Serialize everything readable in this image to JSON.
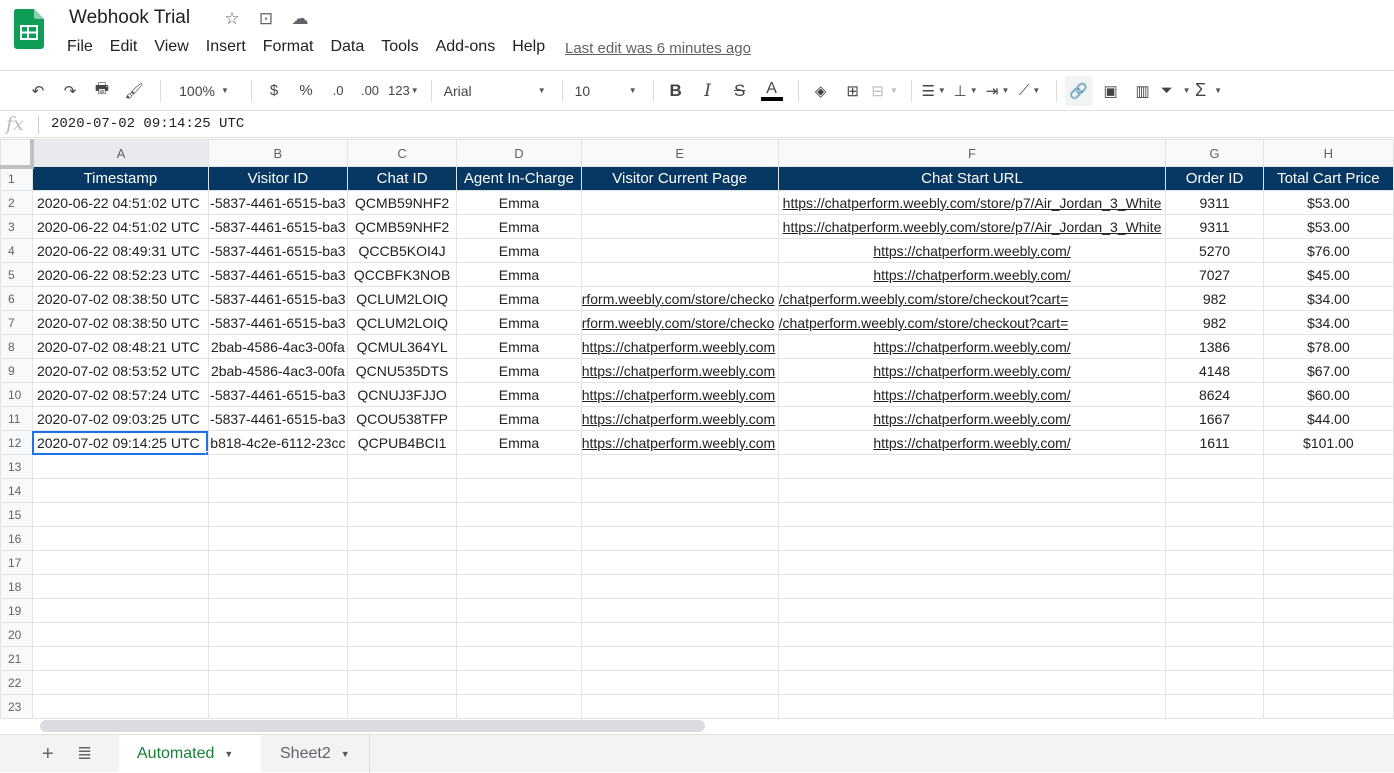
{
  "app": {
    "title": "Webhook Trial",
    "last_edit": "Last edit was 6 minutes ago",
    "menu": [
      "File",
      "Edit",
      "View",
      "Insert",
      "Format",
      "Data",
      "Tools",
      "Add-ons",
      "Help"
    ]
  },
  "toolbar": {
    "zoom": "100%",
    "currency": "$",
    "percent": "%",
    "decrease_decimal": ".0",
    "increase_decimal": ".00",
    "more_formats": "123",
    "font": "Arial",
    "font_size": "10",
    "bold": "B",
    "italic": "I",
    "strike": "S",
    "text_color": "A",
    "sum": "Σ"
  },
  "formula_bar": {
    "fx": "fx",
    "value": "2020-07-02 09:14:25 UTC"
  },
  "sheet": {
    "columns": [
      "A",
      "B",
      "C",
      "D",
      "E",
      "F",
      "G",
      "H"
    ],
    "header_row": [
      "Timestamp",
      "Visitor ID",
      "Chat ID",
      "Agent In-Charge",
      "Visitor Current Page",
      "Chat Start URL",
      "Order ID",
      "Total Cart Price"
    ],
    "rows": [
      [
        "2020-06-22 04:51:02 UTC",
        "-5837-4461-6515-ba3",
        "QCMB59NHF2",
        "Emma",
        "",
        "https://chatperform.weebly.com/store/p7/Air_Jordan_3_White",
        "9311",
        "$53.00"
      ],
      [
        "2020-06-22 04:51:02 UTC",
        "-5837-4461-6515-ba3",
        "QCMB59NHF2",
        "Emma",
        "",
        "https://chatperform.weebly.com/store/p7/Air_Jordan_3_White",
        "9311",
        "$53.00"
      ],
      [
        "2020-06-22 08:49:31 UTC",
        "-5837-4461-6515-ba3",
        "QCCB5KOI4J",
        "Emma",
        "",
        "https://chatperform.weebly.com/",
        "5270",
        "$76.00"
      ],
      [
        "2020-06-22 08:52:23 UTC",
        "-5837-4461-6515-ba3",
        "QCCBFK3NOB",
        "Emma",
        "",
        "https://chatperform.weebly.com/",
        "7027",
        "$45.00"
      ],
      [
        "2020-07-02 08:38:50 UTC",
        "-5837-4461-6515-ba3",
        "QCLUM2LOIQ",
        "Emma",
        "rform.weebly.com/store/checko",
        "/chatperform.weebly.com/store/checkout?cart=",
        "982",
        "$34.00"
      ],
      [
        "2020-07-02 08:38:50 UTC",
        "-5837-4461-6515-ba3",
        "QCLUM2LOIQ",
        "Emma",
        "rform.weebly.com/store/checko",
        "/chatperform.weebly.com/store/checkout?cart=",
        "982",
        "$34.00"
      ],
      [
        "2020-07-02 08:48:21 UTC",
        "2bab-4586-4ac3-00fa",
        "QCMUL364YL",
        "Emma",
        "https://chatperform.weebly.com",
        "https://chatperform.weebly.com/",
        "1386",
        "$78.00"
      ],
      [
        "2020-07-02 08:53:52 UTC",
        "2bab-4586-4ac3-00fa",
        "QCNU535DTS",
        "Emma",
        "https://chatperform.weebly.com",
        "https://chatperform.weebly.com/",
        "4148",
        "$67.00"
      ],
      [
        "2020-07-02 08:57:24 UTC",
        "-5837-4461-6515-ba3",
        "QCNUJ3FJJO",
        "Emma",
        "https://chatperform.weebly.com",
        "https://chatperform.weebly.com/",
        "8624",
        "$60.00"
      ],
      [
        "2020-07-02 09:03:25 UTC",
        "-5837-4461-6515-ba3",
        "QCOU538TFP",
        "Emma",
        "https://chatperform.weebly.com",
        "https://chatperform.weebly.com/",
        "1667",
        "$44.00"
      ],
      [
        "2020-07-02 09:14:25 UTC",
        "b818-4c2e-6112-23cc",
        "QCPUB4BCI1",
        "Emma",
        "https://chatperform.weebly.com",
        "https://chatperform.weebly.com/",
        "1611",
        "$101.00"
      ]
    ],
    "row_count": 23,
    "selected_cell": "A12",
    "header_color": "#073763"
  },
  "tabs": [
    {
      "label": "Automated",
      "active": true
    },
    {
      "label": "Sheet2",
      "active": false
    }
  ]
}
